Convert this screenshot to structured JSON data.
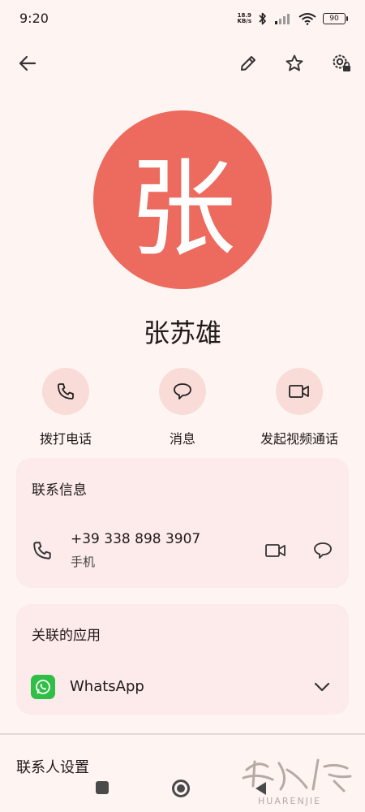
{
  "status_bar": {
    "time": "9:20",
    "net_speed_value": "18.9",
    "net_speed_unit": "KB/s",
    "battery": "90"
  },
  "toolbar": {
    "back_icon": "arrow-left-icon",
    "edit_icon": "pencil-icon",
    "favorite_icon": "star-outline-icon",
    "settings_icon": "gear-lock-icon"
  },
  "contact": {
    "avatar_initial": "张",
    "avatar_color": "#ec6a5e",
    "name": "张苏雄"
  },
  "quick_actions": [
    {
      "label": "拨打电话",
      "icon": "phone-icon"
    },
    {
      "label": "消息",
      "icon": "message-bubble-icon"
    },
    {
      "label": "发起视频通话",
      "icon": "video-camera-icon"
    }
  ],
  "contact_info": {
    "title": "联系信息",
    "phone": {
      "number": "+39 338 898 3907",
      "type": "手机"
    }
  },
  "linked_apps": {
    "title": "关联的应用",
    "apps": [
      {
        "name": "WhatsApp",
        "color": "#2fbe46"
      }
    ]
  },
  "settings": {
    "title": "联系人设置"
  },
  "watermark": {
    "text": "HUARENJIE"
  }
}
